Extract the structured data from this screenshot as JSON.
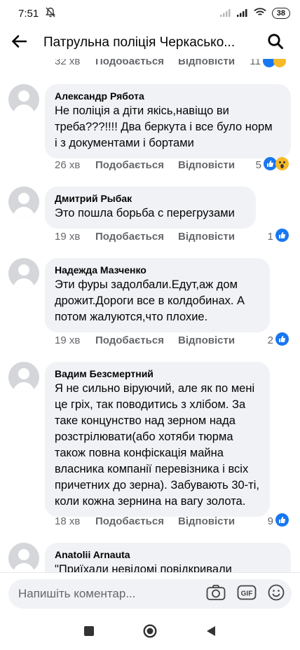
{
  "status_bar": {
    "time": "7:51",
    "battery": "38"
  },
  "header": {
    "title": "Патрульна поліція Черкасько..."
  },
  "top_cut_row": {
    "time": "32 хв",
    "like": "Подобається",
    "reply": "Відповісти",
    "count": "11"
  },
  "comments": [
    {
      "author": "Александр Рябота",
      "lines": [
        "Не поліція а діти якісь,навіщо ви",
        "треба???!!!! Два беркута і все було норм",
        "і з документами і бортами"
      ],
      "time": "26 хв",
      "like": "Подобається",
      "reply": "Відповісти",
      "count": "5",
      "reactions": [
        "like",
        "wow"
      ]
    },
    {
      "author": "Дмитрий Рыбак",
      "lines": [
        "Это пошла борьба с перегрузами"
      ],
      "time": "19 хв",
      "like": "Подобається",
      "reply": "Відповісти",
      "count": "1",
      "reactions": [
        "like"
      ]
    },
    {
      "author": "Надежда Мазченко",
      "lines": [
        "Эти фуры задолбали.Едут,аж дом",
        "дрожит.Дороги все в колдобинах. А",
        "потом жалуются,что плохие."
      ],
      "time": "19 хв",
      "like": "Подобається",
      "reply": "Відповісти",
      "count": "2",
      "reactions": [
        "like"
      ]
    },
    {
      "author": "Вадим Безсмертний",
      "lines": [
        "Я не сильно віруючий, але як по мені",
        "це гріх, так поводитись з хлібом. За",
        "таке концунство над зерном нада",
        "розстрілювати(або хотяби тюрма",
        "також повна конфіскація майна",
        "власника компанії перевізника і всіх",
        "причетних до зерна). Забувають 30-ті,",
        "коли кожна зернина на вагу золота."
      ],
      "time": "18 хв",
      "like": "Подобається",
      "reply": "Відповісти",
      "count": "9",
      "reactions": [
        "like"
      ]
    },
    {
      "author": "Anatolii  Arnauta",
      "lines": [
        "\"Приїхали невідомі повідкривали"
      ]
    }
  ],
  "composer": {
    "placeholder": "Напишіть коментар..."
  },
  "icons": {
    "back": "arrow-left-icon",
    "search": "search-icon",
    "camera": "camera-icon",
    "gif": "gif-icon",
    "emoji": "emoji-icon",
    "like_reaction": "like-reaction-icon",
    "wow_reaction": "wow-reaction-icon"
  },
  "colors": {
    "like_blue": "#1877f2",
    "secondary_text": "#65676b",
    "bubble_bg": "#f0f2f5"
  }
}
